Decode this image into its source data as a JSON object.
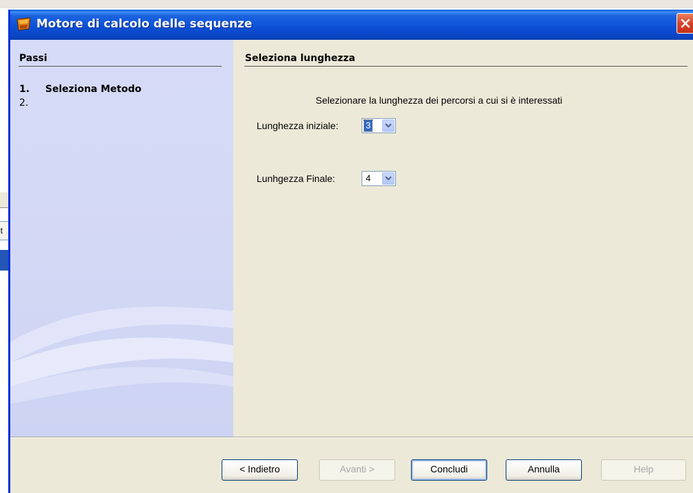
{
  "window": {
    "title": "Motore di calcolo delle sequenze",
    "title_icon": "app-window-icon",
    "close_icon": "close-icon"
  },
  "background": {
    "partial_tab_text": "nt"
  },
  "steps": {
    "heading": "Passi",
    "items": [
      {
        "number": "1.",
        "label": "Seleziona Metodo",
        "current": true
      },
      {
        "number": "2.",
        "label": "",
        "current": false
      }
    ]
  },
  "content": {
    "heading": "Seleziona lunghezza",
    "instruction": "Selezionare la lunghezza dei percorsi a cui si è interessati",
    "start_length": {
      "label": "Lunghezza iniziale:",
      "value": "3"
    },
    "end_length": {
      "label": "Lunhgezza Finale:",
      "value": "4"
    }
  },
  "buttons": {
    "back": "< Indietro",
    "next": "Avanti >",
    "finish": "Concludi",
    "cancel": "Annulla",
    "help": "Help"
  },
  "colors": {
    "titlebar": "#0a4fd4",
    "dialog_face": "#ece9d8",
    "steps_pane": "#d3d8f5",
    "selection": "#316ac5",
    "close_button": "#d9422a"
  }
}
